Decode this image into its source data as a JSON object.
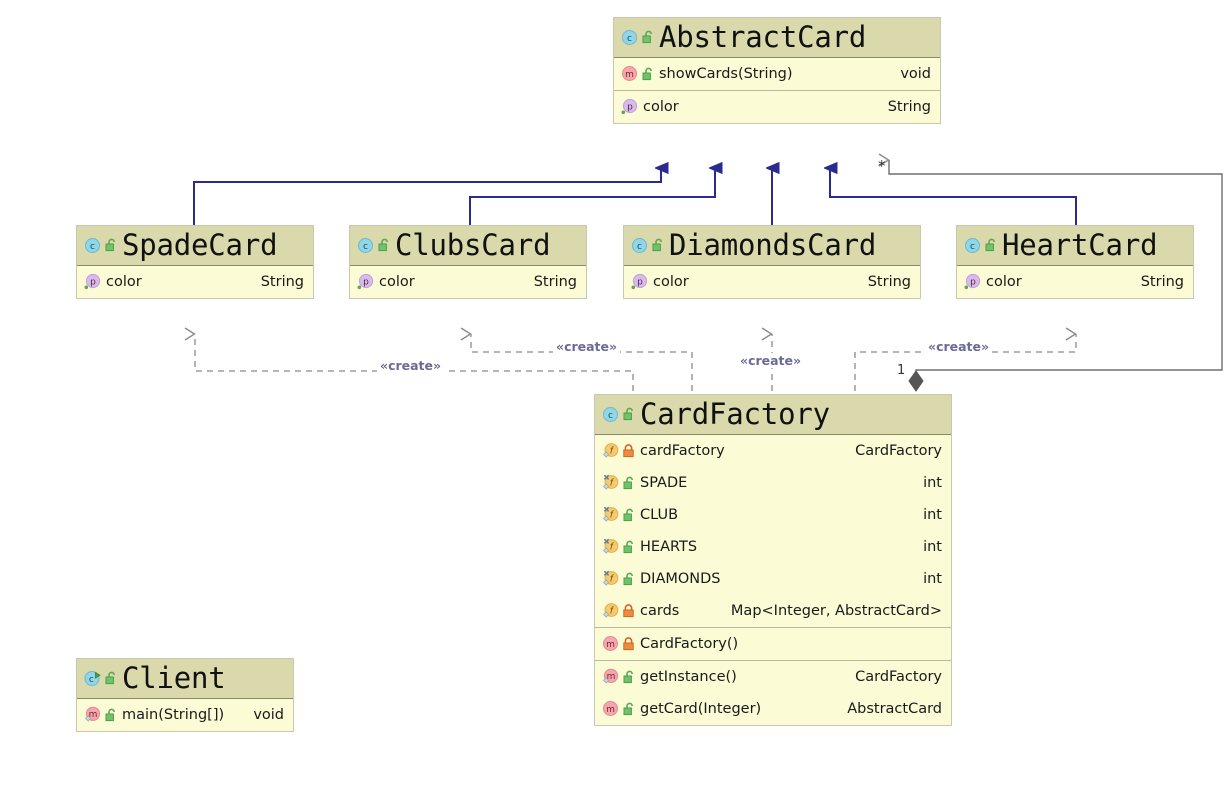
{
  "diagram": {
    "title": "UML Class Diagram",
    "background_color": "#ffffff",
    "header_color": "#d9d9ab",
    "body_color": "#fbfbd6",
    "generalization_color": "#2b2b8f",
    "dependency_color": "#888888",
    "stereotype_color": "#6a6a9a"
  },
  "classes": [
    {
      "id": "abstract-card",
      "name": "AbstractCard",
      "icon": "class-icon",
      "visibility_icon": "unlock-icon",
      "sections": [
        {
          "rows": [
            {
              "icon": "method-icon",
              "visibility_icon": "unlock-icon",
              "name": "showCards(String)",
              "type": "void"
            }
          ]
        },
        {
          "rows": [
            {
              "icon": "property-icon",
              "visibility_icon": "none",
              "name": "color",
              "type": "String"
            }
          ]
        }
      ]
    },
    {
      "id": "spade-card",
      "name": "SpadeCard",
      "icon": "class-icon",
      "visibility_icon": "unlock-icon",
      "sections": [
        {
          "rows": [
            {
              "icon": "property-icon",
              "visibility_icon": "none",
              "name": "color",
              "type": "String"
            }
          ]
        }
      ]
    },
    {
      "id": "clubs-card",
      "name": "ClubsCard",
      "icon": "class-icon",
      "visibility_icon": "unlock-icon",
      "sections": [
        {
          "rows": [
            {
              "icon": "property-icon",
              "visibility_icon": "none",
              "name": "color",
              "type": "String"
            }
          ]
        }
      ]
    },
    {
      "id": "diamonds-card",
      "name": "DiamondsCard",
      "icon": "class-icon",
      "visibility_icon": "unlock-icon",
      "sections": [
        {
          "rows": [
            {
              "icon": "property-icon",
              "visibility_icon": "none",
              "name": "color",
              "type": "String"
            }
          ]
        }
      ]
    },
    {
      "id": "heart-card",
      "name": "HeartCard",
      "icon": "class-icon",
      "visibility_icon": "unlock-icon",
      "sections": [
        {
          "rows": [
            {
              "icon": "property-icon",
              "visibility_icon": "none",
              "name": "color",
              "type": "String"
            }
          ]
        }
      ]
    },
    {
      "id": "card-factory",
      "name": "CardFactory",
      "icon": "class-icon",
      "visibility_icon": "unlock-icon",
      "sections": [
        {
          "rows": [
            {
              "icon": "field-icon",
              "visibility_icon": "lock-icon",
              "name": "cardFactory",
              "type": "CardFactory"
            },
            {
              "icon": "static-field-icon",
              "visibility_icon": "unlock-icon",
              "name": "SPADE",
              "type": "int"
            },
            {
              "icon": "static-field-icon",
              "visibility_icon": "unlock-icon",
              "name": "CLUB",
              "type": "int"
            },
            {
              "icon": "static-field-icon",
              "visibility_icon": "unlock-icon",
              "name": "HEARTS",
              "type": "int"
            },
            {
              "icon": "static-field-icon",
              "visibility_icon": "unlock-icon",
              "name": "DIAMONDS",
              "type": "int"
            },
            {
              "icon": "field-icon",
              "visibility_icon": "lock-icon",
              "name": "cards",
              "type": "Map<Integer, AbstractCard>"
            }
          ]
        },
        {
          "rows": [
            {
              "icon": "method-icon",
              "visibility_icon": "lock-icon",
              "name": "CardFactory()",
              "type": ""
            }
          ]
        },
        {
          "rows": [
            {
              "icon": "static-method-icon",
              "visibility_icon": "unlock-icon",
              "name": "getInstance()",
              "type": "CardFactory"
            },
            {
              "icon": "method-icon",
              "visibility_icon": "unlock-icon",
              "name": "getCard(Integer)",
              "type": "AbstractCard"
            }
          ]
        }
      ]
    },
    {
      "id": "client",
      "name": "Client",
      "icon": "runnable-class-icon",
      "visibility_icon": "unlock-icon",
      "sections": [
        {
          "rows": [
            {
              "icon": "static-method-icon",
              "visibility_icon": "unlock-icon",
              "name": "main(String[])",
              "type": "void"
            }
          ]
        }
      ]
    }
  ],
  "relations": {
    "generalizations": [
      {
        "from": "SpadeCard",
        "to": "AbstractCard",
        "type": "generalization"
      },
      {
        "from": "ClubsCard",
        "to": "AbstractCard",
        "type": "generalization"
      },
      {
        "from": "DiamondsCard",
        "to": "AbstractCard",
        "type": "generalization"
      },
      {
        "from": "HeartCard",
        "to": "AbstractCard",
        "type": "generalization"
      }
    ],
    "dependencies": [
      {
        "from": "CardFactory",
        "to": "SpadeCard",
        "label": "«create»"
      },
      {
        "from": "CardFactory",
        "to": "ClubsCard",
        "label": "«create»"
      },
      {
        "from": "CardFactory",
        "to": "DiamondsCard",
        "label": "«create»"
      },
      {
        "from": "CardFactory",
        "to": "HeartCard",
        "label": "«create»"
      }
    ],
    "compositions": [
      {
        "from": "CardFactory",
        "to": "AbstractCard",
        "source_multiplicity": "1",
        "target_multiplicity": "*"
      }
    ]
  },
  "labels": {
    "create_1": "«create»",
    "create_2": "«create»",
    "create_3": "«create»",
    "create_4": "«create»",
    "mult_one": "1",
    "mult_many": "*"
  }
}
